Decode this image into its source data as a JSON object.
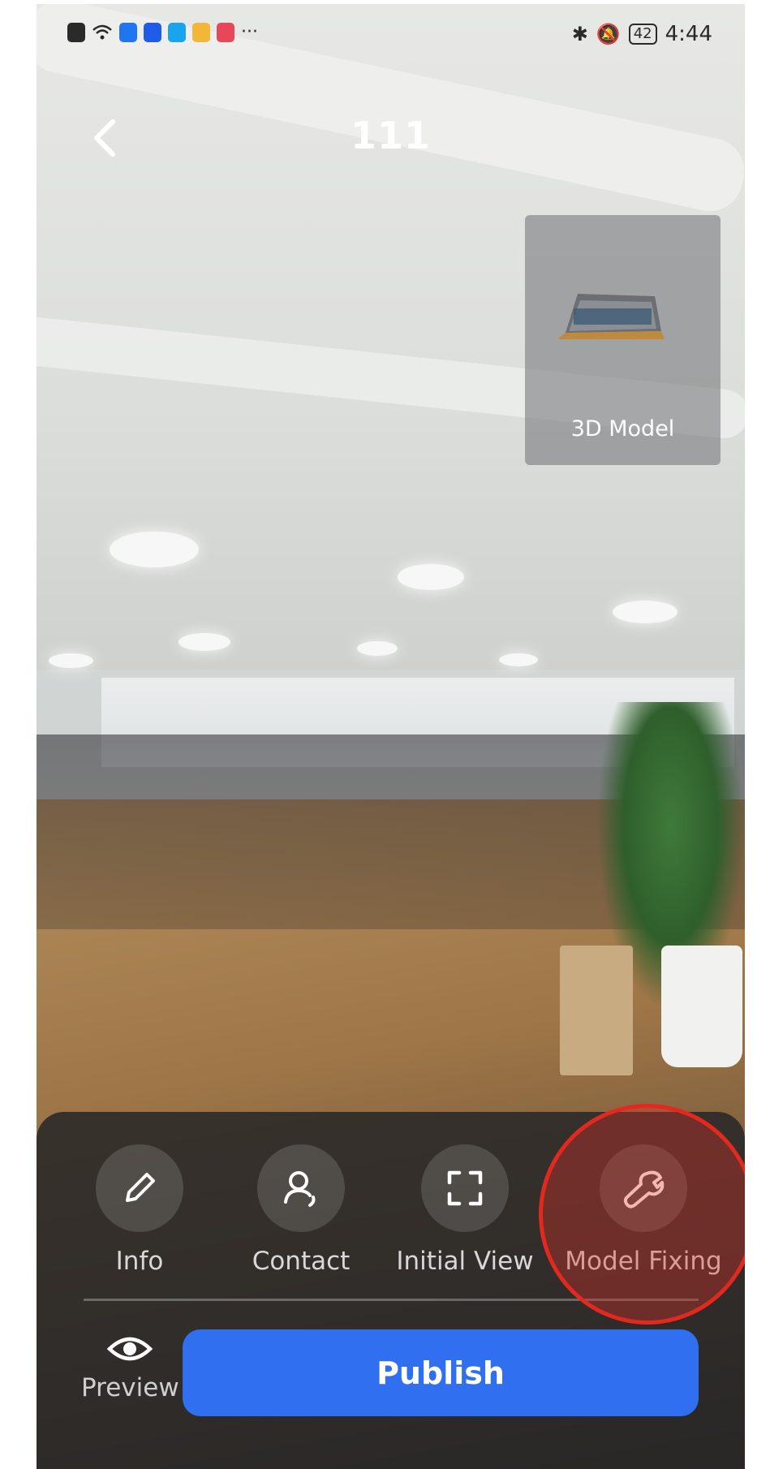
{
  "statusbar": {
    "battery": "42",
    "time": "4:44",
    "overflow": "···"
  },
  "header": {
    "title": "111",
    "back_icon": "chevron-left-icon"
  },
  "model_card": {
    "label": "3D Model"
  },
  "toolbar": {
    "items": [
      {
        "label": "Info",
        "icon": "pencil-icon"
      },
      {
        "label": "Contact",
        "icon": "contact-icon"
      },
      {
        "label": "Initial View",
        "icon": "frame-icon"
      },
      {
        "label": "Model Fixing",
        "icon": "wrench-icon"
      }
    ]
  },
  "bottom": {
    "preview_label": "Preview",
    "publish_label": "Publish"
  },
  "colors": {
    "accent": "#2f6ff0",
    "highlight": "#e1291f",
    "panel": "#262628"
  }
}
